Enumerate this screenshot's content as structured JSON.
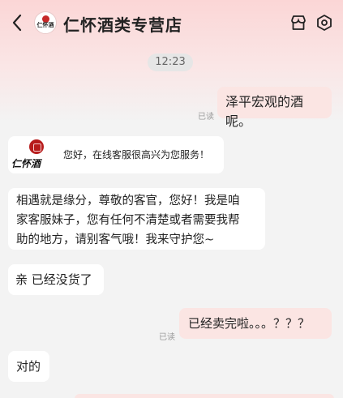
{
  "header": {
    "back_icon": "chevron-left-icon",
    "shop_name": "仁怀酒类专营店",
    "shop_icon": "store-icon",
    "settings_icon": "hexagon-gear-icon"
  },
  "chat": {
    "timestamp": "12:23",
    "read_label": "已读",
    "messages": [
      {
        "side": "right",
        "text": "泽平宏观的酒呢。",
        "read": "已读"
      },
      {
        "side": "left",
        "type": "card",
        "brand": "仁怀酒",
        "text": "您好，在线客服很高兴为您服务！"
      },
      {
        "side": "left",
        "text_lines": [
          "相遇就是缘分，尊敬的客官，您好！我是咱",
          "家客服妹子，您有任何不清楚或者需要我帮",
          "助的地方，请别客气哦！我来守护您~"
        ]
      },
      {
        "side": "left",
        "text": "亲 已经没货了"
      },
      {
        "side": "right",
        "text": "已经卖完啦。。。？？？",
        "read": "已读"
      },
      {
        "side": "left",
        "text": "对的"
      }
    ]
  },
  "colors": {
    "accent_pink": "#fbe5e3",
    "brand_red": "#c62828",
    "background": "#f3f3f3"
  }
}
